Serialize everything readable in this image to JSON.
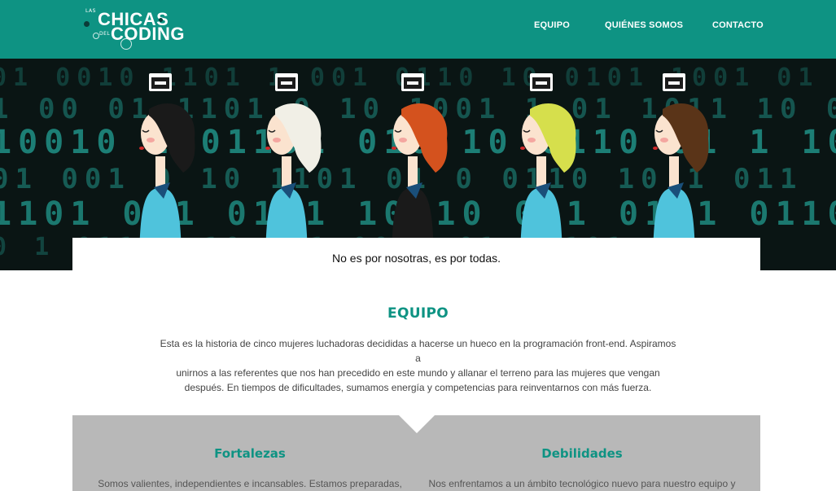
{
  "brand": {
    "logo_top": "LAS",
    "logo_word1": "CHICAS",
    "logo_mid": "DEL",
    "logo_word2": "CODING"
  },
  "nav": {
    "items": [
      {
        "label": "EQUIPO"
      },
      {
        "label": "QUIÉNES SOMOS"
      },
      {
        "label": "CONTACTO"
      }
    ]
  },
  "hero": {
    "characters": [
      {
        "icon": "curly-braces-icon",
        "hair": "#1a1a1a",
        "top": "#4fc3dc"
      },
      {
        "icon": "code-tag-icon",
        "hair": "#f1efe6",
        "top": "#4fc3dc"
      },
      {
        "icon": "keyboard-icon",
        "hair": "#d4521e",
        "top": "#1a1a1a"
      },
      {
        "icon": "html-file-icon",
        "hair": "#d6df4c",
        "top": "#4fc3dc"
      },
      {
        "icon": "code-settings-icon",
        "hair": "#5a3418",
        "top": "#4fc3dc"
      }
    ],
    "tagline": "No es por nosotras, es por todas."
  },
  "equipo": {
    "title": "EQUIPO",
    "lines": [
      "Esta es la historia de cinco mujeres luchadoras decididas a hacerse un hueco en la programación front-end. Aspiramos a",
      "unirnos a las referentes que nos han precedido en este mundo y allanar el terreno para las mujeres que vengan",
      "después. En tiempos de dificultades, sumamos energía y competencias para reinventarnos con más fuerza."
    ]
  },
  "swot": {
    "strengths_title": "Fortalezas",
    "strengths_text": "Somos valientes, independientes e incansables. Estamos preparadas,",
    "weaknesses_title": "Debilidades",
    "weaknesses_text": "Nos enfrentamos a un ámbito tecnológico nuevo para nuestro equipo y"
  },
  "colors": {
    "brand": "#0e9383",
    "grey_panel": "#b8b8b8"
  }
}
